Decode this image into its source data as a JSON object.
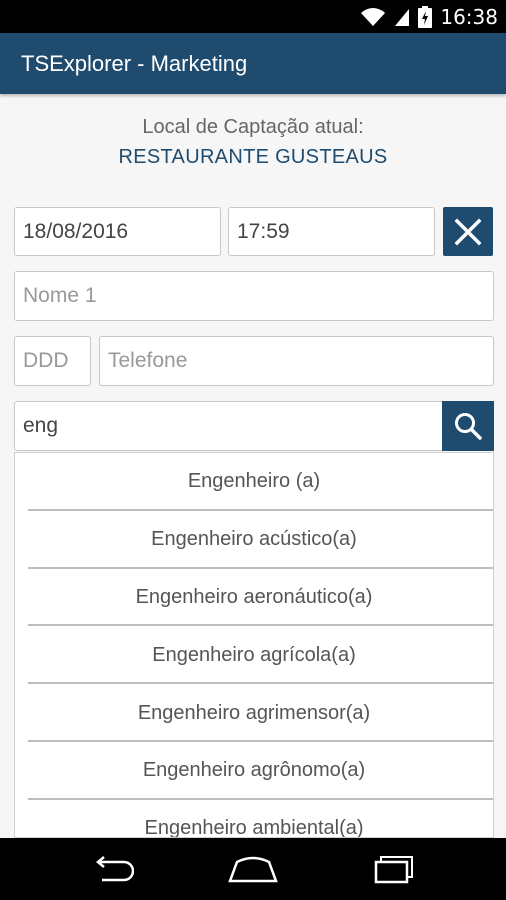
{
  "status_bar": {
    "time": "16:38",
    "icons": [
      "wifi-icon",
      "signal-icon",
      "battery-icon"
    ]
  },
  "app_bar": {
    "title": "TSExplorer - Marketing"
  },
  "local": {
    "label": "Local de Captação atual:",
    "name": "RESTAURANTE GUSTEAUS"
  },
  "form": {
    "date": "18/08/2016",
    "time": "17:59",
    "name_placeholder": "Nome 1",
    "ddd_placeholder": "DDD",
    "phone_placeholder": "Telefone",
    "search_value": "eng"
  },
  "dropdown": {
    "items": [
      "Engenheiro (a)",
      "Engenheiro acústico(a)",
      "Engenheiro aeronáutico(a)",
      "Engenheiro agrícola(a)",
      "Engenheiro agrimensor(a)",
      "Engenheiro agrônomo(a)",
      "Engenheiro ambiental(a)"
    ]
  },
  "colors": {
    "accent": "#1f4b6e",
    "background": "#f6f6f6"
  },
  "nav_bar": {
    "icons": [
      "back-icon",
      "home-icon",
      "recents-icon"
    ]
  }
}
